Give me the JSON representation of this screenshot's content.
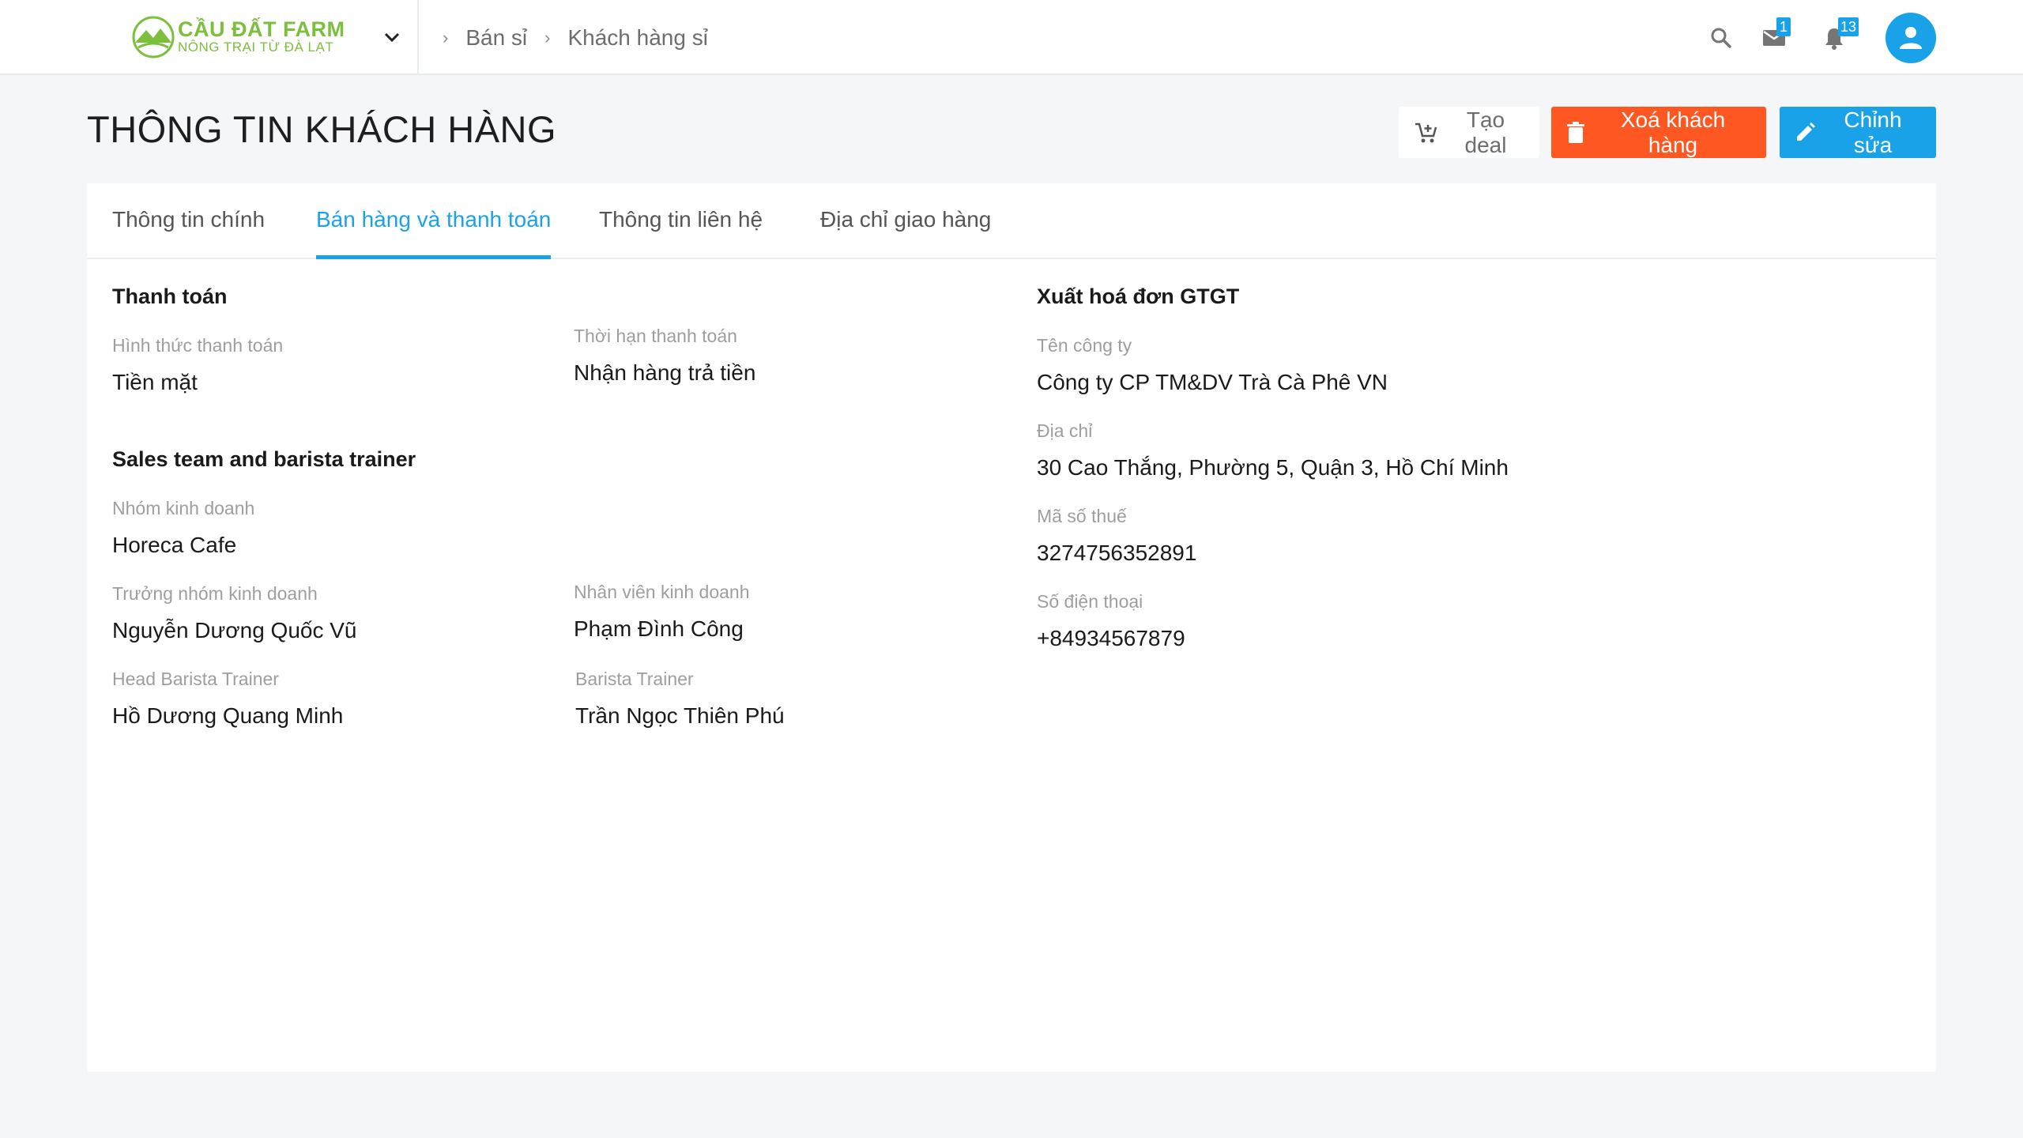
{
  "brand": {
    "name": "CẦU ĐẤT FARM",
    "tagline": "NÔNG TRẠI TỪ ĐÀ LẠT",
    "color": "#7cbf3c"
  },
  "breadcrumb": [
    "Bán sỉ",
    "Khách hàng sỉ"
  ],
  "notifications": {
    "mail_count": "1",
    "bell_count": "13"
  },
  "header": {
    "title": "THÔNG TIN KHÁCH HÀNG",
    "buttons": {
      "create_deal": "Tạo deal",
      "delete_customer": "Xoá khách hàng",
      "edit": "Chỉnh sửa"
    }
  },
  "tabs": [
    {
      "label": "Thông tin chính",
      "active": false
    },
    {
      "label": "Bán hàng và thanh toán",
      "active": true
    },
    {
      "label": "Thông tin liên hệ",
      "active": false
    },
    {
      "label": "Địa chỉ giao hàng",
      "active": false
    }
  ],
  "payment": {
    "title": "Thanh toán",
    "method_label": "Hình thức thanh toán",
    "method_value": "Tiền mặt",
    "term_label": "Thời hạn thanh toán",
    "term_value": "Nhận hàng trả tiền"
  },
  "sales_team": {
    "title": "Sales team and barista trainer",
    "group_label": "Nhóm kinh doanh",
    "group_value": "Horeca Cafe",
    "leader_label": "Trưởng nhóm kinh doanh",
    "leader_value": "Nguyễn Dương Quốc Vũ",
    "staff_label": "Nhân viên kinh doanh",
    "staff_value": "Phạm Đình Công",
    "head_trainer_label": "Head Barista Trainer",
    "head_trainer_value": "Hồ Dương Quang Minh",
    "trainer_label": "Barista Trainer",
    "trainer_value": "Trần Ngọc Thiên Phú"
  },
  "invoice": {
    "title": "Xuất hoá đơn GTGT",
    "company_label": "Tên công ty",
    "company_value": "Công ty CP TM&DV Trà Cà Phê VN",
    "address_label": "Địa chỉ",
    "address_value": "30 Cao Thắng, Phường 5, Quận 3, Hồ Chí Minh",
    "tax_label": "Mã số thuế",
    "tax_value": "3274756352891",
    "phone_label": "Số điện thoại",
    "phone_value": "+84934567879"
  },
  "colors": {
    "primary": "#1aa2e8",
    "danger": "#ff5722",
    "background": "#f4f6f8"
  }
}
